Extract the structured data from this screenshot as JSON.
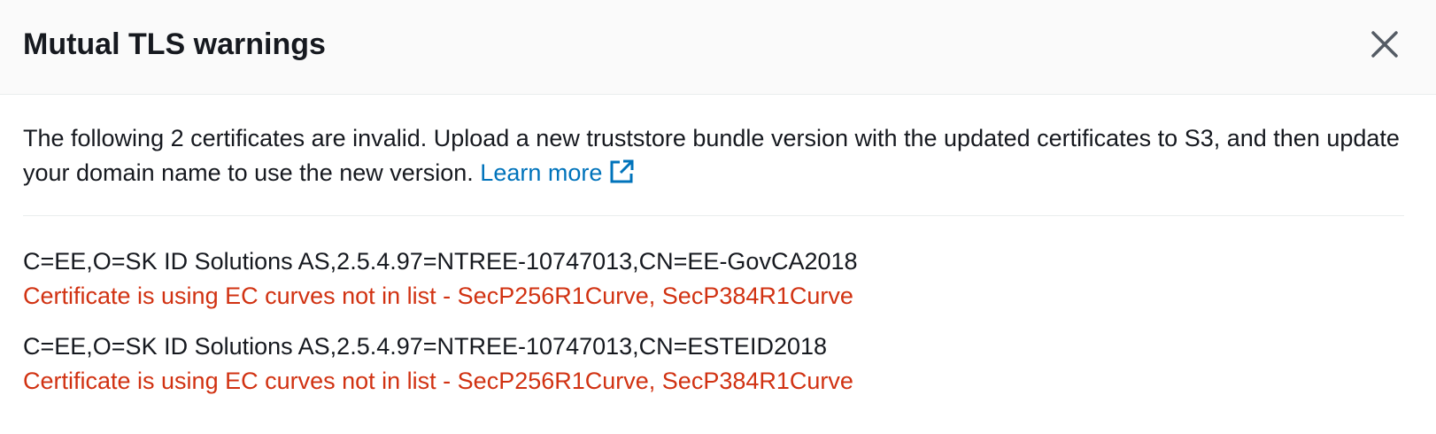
{
  "modal": {
    "title": "Mutual TLS warnings",
    "close_icon": "close-icon"
  },
  "intro": {
    "text": "The following 2 certificates are invalid. Upload a new truststore bundle version with the updated certificates to S3, and then update your domain name to use the new version.",
    "link_label": "Learn more",
    "link_icon": "external-link-icon",
    "link_color": "#0073bb"
  },
  "certificates": [
    {
      "name": "C=EE,O=SK ID Solutions AS,2.5.4.97=NTREE-10747013,CN=EE-GovCA2018",
      "error": "Certificate is using EC curves not in list - SecP256R1Curve, SecP384R1Curve"
    },
    {
      "name": "C=EE,O=SK ID Solutions AS,2.5.4.97=NTREE-10747013,CN=ESTEID2018",
      "error": "Certificate is using EC curves not in list - SecP256R1Curve, SecP384R1Curve"
    }
  ],
  "colors": {
    "error": "#d13212",
    "text": "#16191f",
    "header_bg": "#fafafa"
  }
}
